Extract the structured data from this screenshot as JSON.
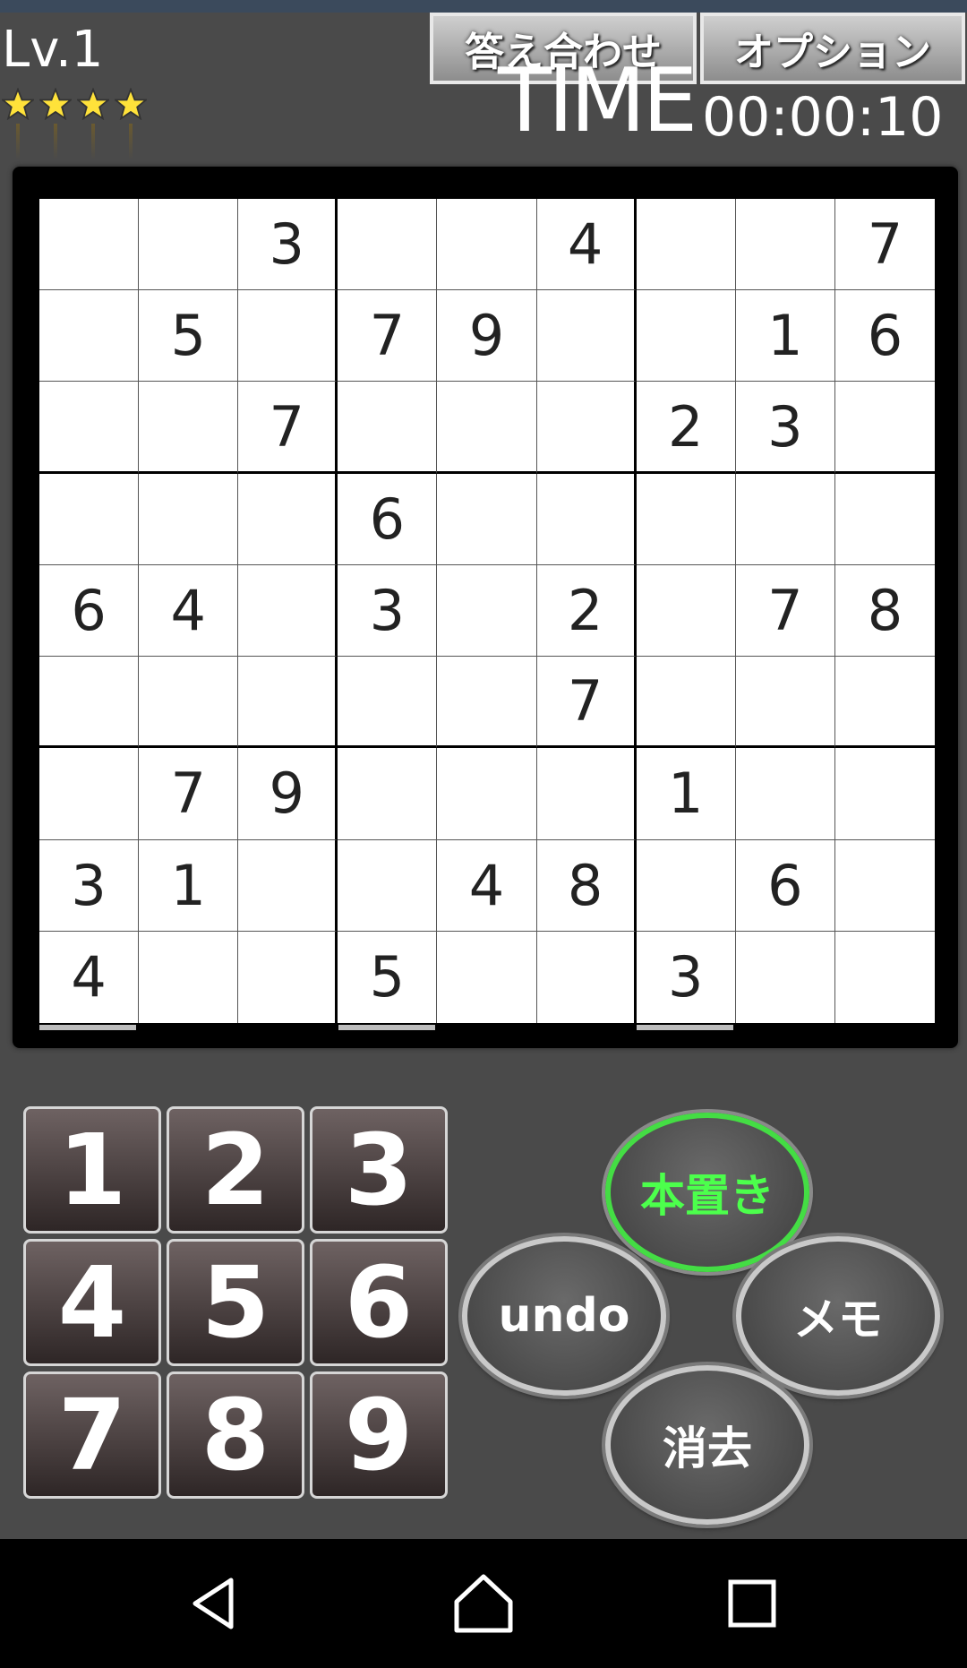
{
  "header": {
    "level": "Lv.1",
    "stars": [
      "star-icon",
      "star-icon",
      "star-icon",
      "star-icon"
    ],
    "check_answer_label": "答え合わせ",
    "options_label": "オプション",
    "time_label": "TIME",
    "time_value": "00:00:10"
  },
  "board": {
    "rows": [
      [
        "",
        "",
        "3",
        "",
        "",
        "4",
        "",
        "",
        "7"
      ],
      [
        "",
        "5",
        "",
        "7",
        "9",
        "",
        "",
        "1",
        "6"
      ],
      [
        "",
        "",
        "7",
        "",
        "",
        "",
        "2",
        "3",
        ""
      ],
      [
        "",
        "",
        "",
        "6",
        "",
        "",
        "",
        "",
        ""
      ],
      [
        "6",
        "4",
        "",
        "3",
        "",
        "2",
        "",
        "7",
        "8"
      ],
      [
        "",
        "",
        "",
        "",
        "",
        "7",
        "",
        "",
        ""
      ],
      [
        "",
        "7",
        "9",
        "",
        "",
        "",
        "1",
        "",
        ""
      ],
      [
        "3",
        "1",
        "",
        "",
        "4",
        "8",
        "",
        "6",
        ""
      ],
      [
        "4",
        "",
        "",
        "5",
        "",
        "",
        "3",
        "",
        ""
      ]
    ]
  },
  "numpad": {
    "keys": [
      "1",
      "2",
      "3",
      "4",
      "5",
      "6",
      "7",
      "8",
      "9"
    ]
  },
  "actions": {
    "place_label": "本置き",
    "undo_label": "undo",
    "memo_label": "メモ",
    "erase_label": "消去",
    "place_color": "#4cff4c"
  },
  "nav": {
    "back_icon": "back-triangle-icon",
    "home_icon": "home-icon",
    "recent_icon": "recent-apps-icon"
  }
}
